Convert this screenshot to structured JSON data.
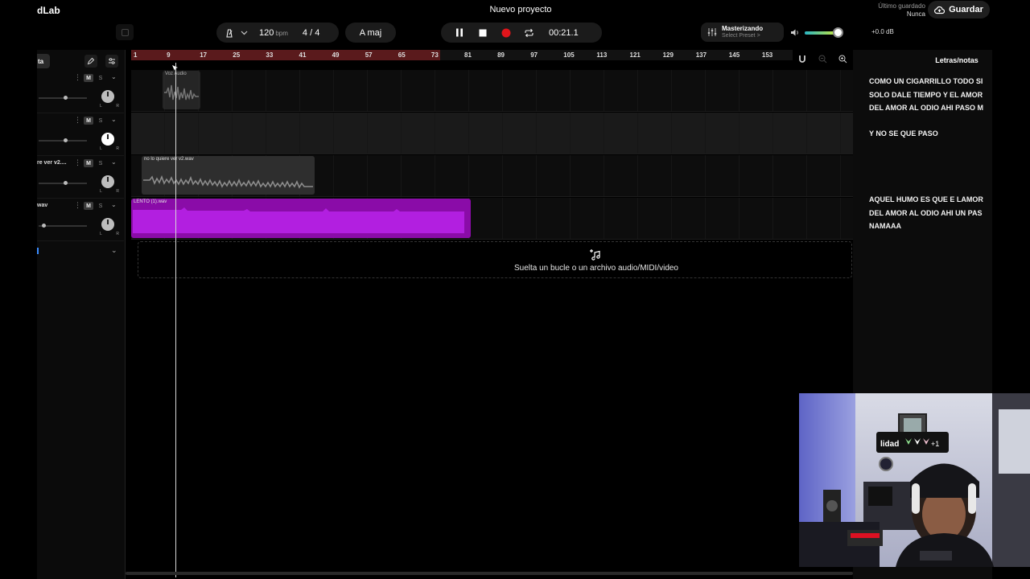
{
  "app": {
    "logo": "dLab",
    "project_title": "Nuevo proyecto",
    "save_status_label": "Último guardado",
    "save_status_value": "Nunca",
    "save_button": "Guardar"
  },
  "transport": {
    "bpm": "120",
    "bpm_unit": "bpm",
    "time_signature": "4 / 4",
    "key": "A maj",
    "time": "00:21.1",
    "is_playing": true
  },
  "mastering": {
    "label": "Masterizando",
    "preset": "Select Preset >"
  },
  "master_volume": {
    "db": "+0.0 dB",
    "level": 0.9
  },
  "track_panel": {
    "tab_label": "ta"
  },
  "tracks": [
    {
      "name": "",
      "mute": "M",
      "solo": "S",
      "fader": 0.55
    },
    {
      "name": "",
      "mute": "M",
      "solo": "S",
      "fader": 0.55
    },
    {
      "name": "re ver v2....",
      "mute": "M",
      "solo": "S",
      "fader": 0.55
    },
    {
      "name": "wav",
      "mute": "M",
      "solo": "S",
      "fader": 0.1
    }
  ],
  "ruler": {
    "ticks": [
      "1",
      "9",
      "17",
      "25",
      "33",
      "41",
      "49",
      "57",
      "65",
      "73",
      "81",
      "89",
      "97",
      "105",
      "113",
      "121",
      "129",
      "137",
      "145",
      "153"
    ]
  },
  "clips": [
    {
      "name": "Voz Audio",
      "color": "#2e2e2e"
    },
    {
      "name": "no lo quiere ver v2.wav",
      "color": "#2e2e2e"
    },
    {
      "name": "LENTO (1).wav",
      "color": "#8a0ca8"
    }
  ],
  "drop_zone": {
    "text": "Suelta un bucle o un archivo audio/MIDI/video"
  },
  "lyrics": {
    "title": "Letras/notas",
    "lines": [
      "COMO UN CIGARRILLO TODO SI",
      "SOLO DALE  TIEMPO Y EL AMOR",
      " DEL AMOR AL ODIO AHI PASO M",
      "Y NO SE QUE PASO",
      "AQUEL HUMO ES QUE E LAMOR",
      "DEL AMOR AL ODIO AHI UN PAS",
      "NAMAAA"
    ]
  },
  "webcam": {
    "sign_text": "lidad",
    "counter": "+1"
  }
}
